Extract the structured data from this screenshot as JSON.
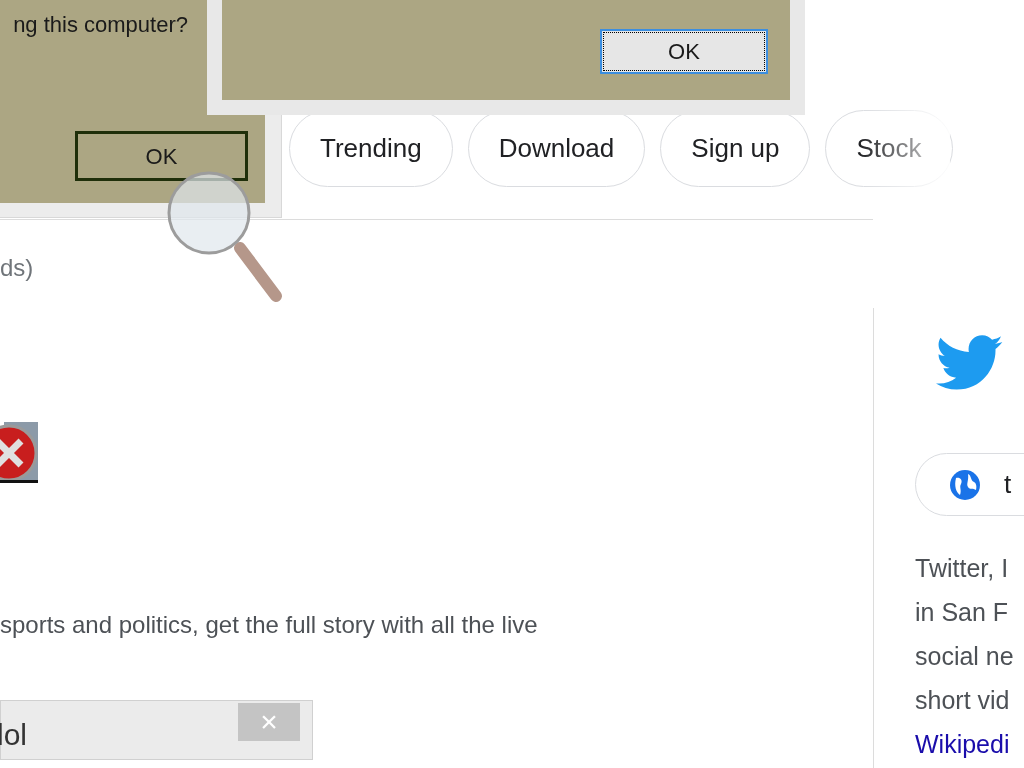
{
  "dialogs": [
    {
      "message": "ng this computer?",
      "button": "OK",
      "focused": false
    },
    {
      "button": "OK",
      "focused": true
    }
  ],
  "chips": [
    {
      "label": "Trending"
    },
    {
      "label": "Download"
    },
    {
      "label": "Sign up"
    },
    {
      "label": "Stock"
    }
  ],
  "result_note": "ds)",
  "snippet": "sports and politics, get the full story with all the live",
  "notification": {
    "text": "lol",
    "close": "×"
  },
  "knowledge_panel": {
    "site": "t",
    "lines": [
      "Twitter, I",
      "in San F",
      "social ne",
      "short vid"
    ],
    "link": "Wikipedi"
  }
}
